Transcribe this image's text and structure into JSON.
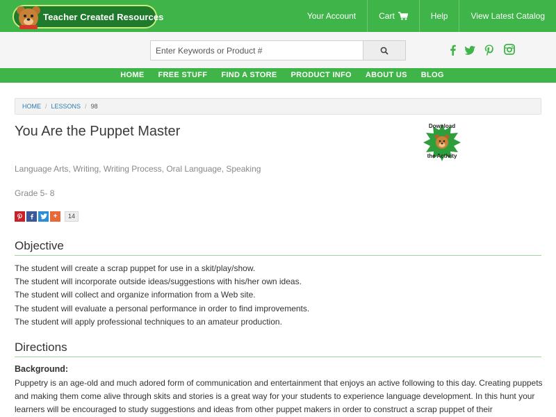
{
  "header": {
    "logo_text": "Teacher Created Resources",
    "links": [
      {
        "label": "Your Account"
      },
      {
        "label": "Cart"
      },
      {
        "label": "Help"
      },
      {
        "label": "View Latest Catalog"
      }
    ]
  },
  "search": {
    "placeholder": "Enter Keywords or Product #",
    "button_icon": "search-icon"
  },
  "social": [
    "facebook-icon",
    "twitter-icon",
    "pinterest-icon",
    "instagram-icon"
  ],
  "nav": [
    "HOME",
    "FREE STUFF",
    "FIND A STORE",
    "PRODUCT INFO",
    "ABOUT US",
    "BLOG"
  ],
  "breadcrumb": {
    "home": "HOME",
    "lessons": "LESSONS",
    "current": "98"
  },
  "lesson": {
    "title": "You Are the Puppet Master",
    "subjects": "Language Arts, Writing, Writing Process, Oral Language, Speaking",
    "grade": "Grade 5- 8",
    "download_top": "Download",
    "download_bottom": "the Activity"
  },
  "share": {
    "count": "14",
    "plus": "+"
  },
  "objective": {
    "heading": "Objective",
    "items": [
      "The student will create a scrap puppet for use in a skit/play/show.",
      "The student will incorporate outside ideas/suggestions with his/her own ideas.",
      "The student will collect and organize information from a Web site.",
      "The student will evaluate a personal performance in order to find improvements.",
      "The student will apply professional techniques to an amateur production."
    ]
  },
  "directions": {
    "heading": "Directions",
    "background_label": "Background:",
    "background_text": "Puppetry is an age-old and much adored form of communication and entertainment that enjoys an active following to this day. Creating puppets and making them come alive through skits and stories is a great way for your students to experience language development. In this hunt your learners will be encouraged to study suggestions and ideas from other puppet makers in order to construct a scrap puppet of their"
  },
  "colors": {
    "brand_green": "#3fb449",
    "link_blue": "#2a7ab0"
  }
}
